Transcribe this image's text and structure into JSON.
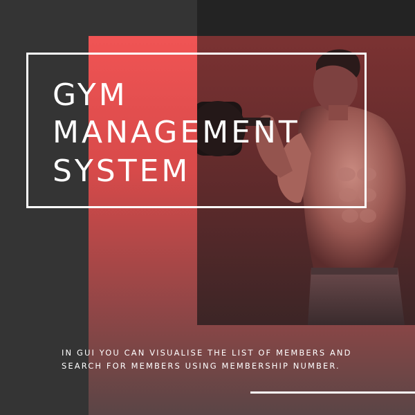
{
  "poster": {
    "title_lines": [
      "GYM",
      "MANAGEMENT",
      "SYSTEM"
    ],
    "caption_lines": [
      "IN GUI YOU CAN VISUALISE THE LIST OF MEMBERS AND",
      "SEARCH FOR MEMBERS USING MEMBERSHIP NUMBER."
    ]
  },
  "colors": {
    "background_dark": "#343434",
    "panel_dark": "#232323",
    "accent_red": "#f05454",
    "text": "#ffffff"
  }
}
